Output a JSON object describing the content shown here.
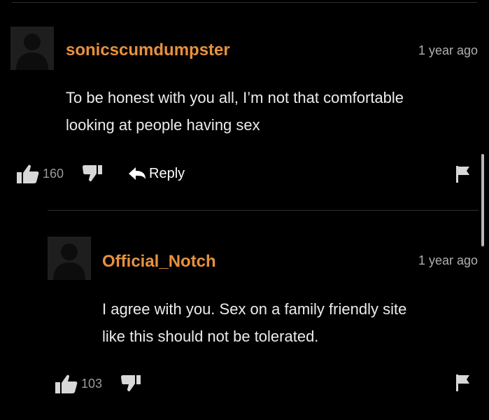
{
  "comments": [
    {
      "username": "sonicscumdumpster",
      "timestamp": "1 year ago",
      "lines": [
        "To be honest with you all, I’m not that comfortable",
        "looking at people having sex"
      ],
      "likes": "160",
      "reply_label": "Reply"
    },
    {
      "username": "Official_Notch",
      "timestamp": "1 year ago",
      "lines": [
        "I agree with you. Sex on a family friendly site",
        "like this should not be tolerated."
      ],
      "likes": "103"
    }
  ],
  "icons": {
    "avatar": "avatar-placeholder-icon",
    "like": "thumbs-up-icon",
    "dislike": "thumbs-down-icon",
    "reply": "reply-arrow-icon",
    "flag": "flag-icon"
  },
  "colors": {
    "background": "#000000",
    "username": "#e8913e",
    "text": "#ececec",
    "muted": "#9a9a9a",
    "divider": "#2e2e2e"
  }
}
